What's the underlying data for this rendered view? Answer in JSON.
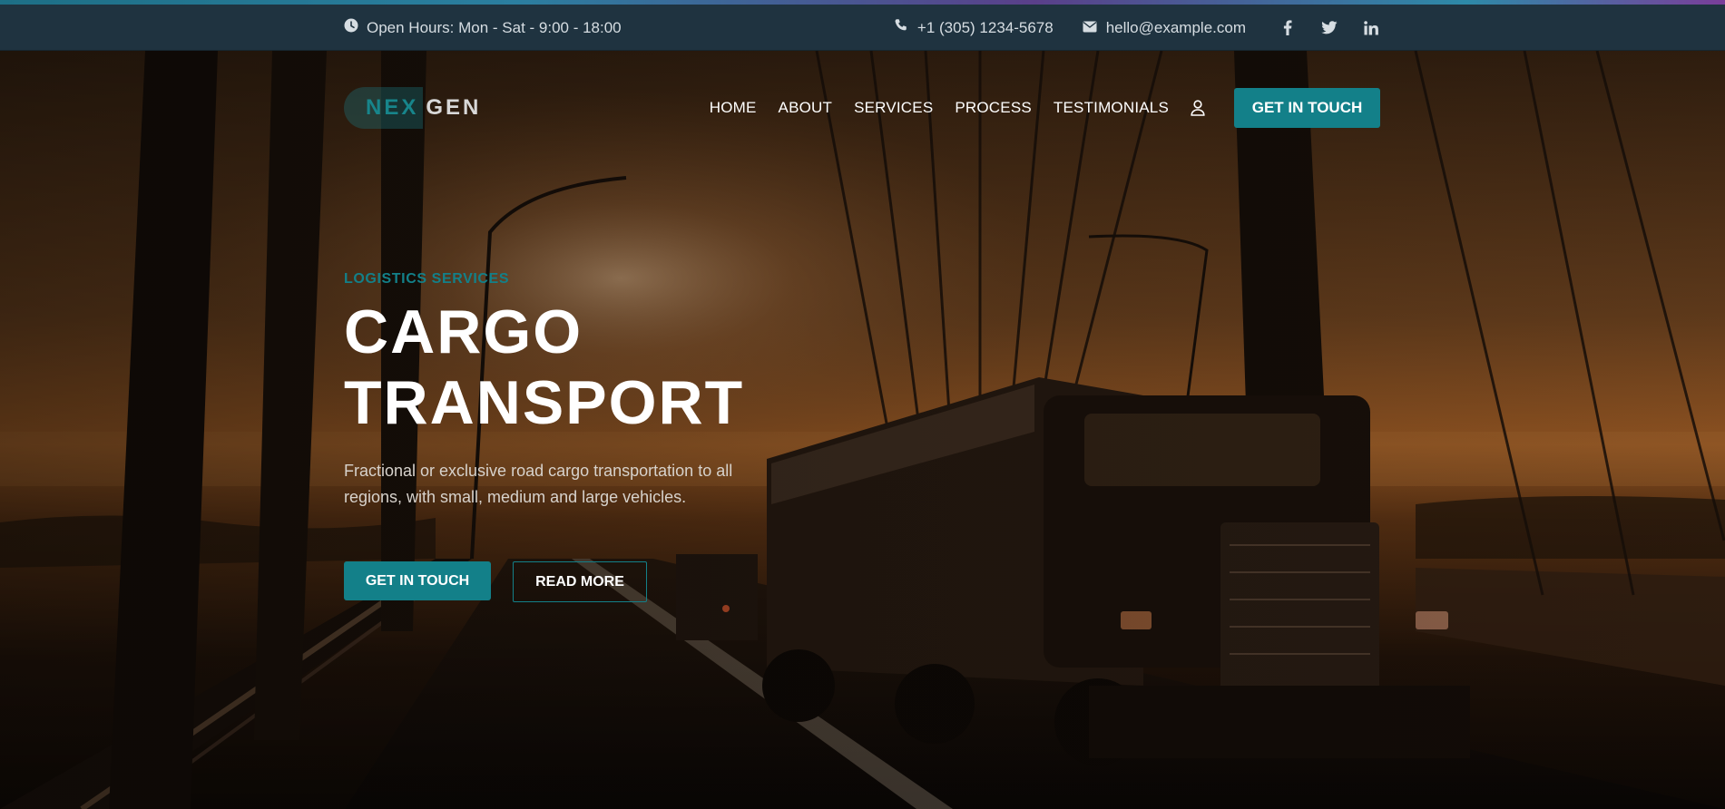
{
  "topbar": {
    "hours": "Open Hours: Mon - Sat - 9:00 - 18:00",
    "phone": "+1 (305) 1234-5678",
    "email": "hello@example.com",
    "social": [
      "facebook-icon",
      "twitter-icon",
      "linkedin-icon"
    ]
  },
  "brand": {
    "part1": "NEX",
    "part2": "GEN"
  },
  "nav": {
    "items": [
      "HOME",
      "ABOUT",
      "SERVICES",
      "PROCESS",
      "TESTIMONIALS"
    ],
    "cta": "GET IN TOUCH"
  },
  "hero": {
    "eyebrow": "LOGISTICS SERVICES",
    "title_line1": "CARGO",
    "title_line2": "TRANSPORT",
    "description": "Fractional or exclusive road cargo transportation to all regions, with small, medium and large vehicles.",
    "primary_cta": "GET IN TOUCH",
    "secondary_cta": "READ MORE"
  },
  "colors": {
    "accent": "#138089",
    "topbar_bg": "#1f3340",
    "text_light": "#ffffff"
  }
}
